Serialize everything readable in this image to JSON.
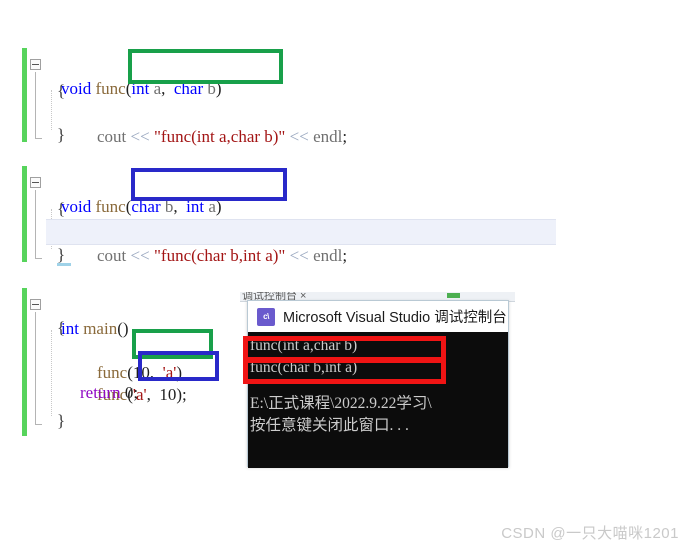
{
  "editor": {
    "language": "cpp",
    "functions": [
      {
        "signature_prefix": "void func",
        "params": "(int a,  char b)",
        "open_brace": "{",
        "body": "cout << \"func(int a,char b)\" << endl;",
        "close_brace": "}"
      },
      {
        "signature_prefix": "void func",
        "params": "(char b,  int a)",
        "open_brace": "{",
        "body": "cout << \"func(char b,int a)\" << endl;",
        "close_brace": "}"
      }
    ],
    "main": {
      "signature": "int main()",
      "open_brace": "{",
      "call1_prefix": "func",
      "call1_args": "(10,  'a')",
      "call2_prefix": "func",
      "call2_args": "('a',  10);",
      "return_stmt": "return 0;",
      "close_brace": "}"
    },
    "tokens": {
      "kw_void": "void",
      "kw_int": "int",
      "kw_char": "int",
      "kw_return": "return",
      "id_cout": "cout",
      "id_endl": "endl",
      "op_shift": "<<"
    },
    "colors": {
      "keyword": "#0000ff",
      "function": "#8a6a3b",
      "identifier": "#707070",
      "string": "#a31515",
      "operator": "#9aa8c0",
      "return_keyword": "#8f08c4",
      "change_bar": "#57d45c",
      "current_line_bg": "#eef1fa"
    }
  },
  "annotations": {
    "green_label": "green-highlight-box",
    "blue_label": "blue-highlight-box",
    "red_label": "red-highlight-box",
    "green_color": "#18a04a",
    "blue_color": "#2929c9",
    "red_color": "#f01414"
  },
  "console": {
    "title": "Microsoft Visual Studio 调试控制台",
    "icon_text": "c\\",
    "output_line1": "func(int a,char b)",
    "output_line2": "func(char b,int a)",
    "path_line": "E:\\正式课程\\2022.9.22学习\\",
    "prompt_line": "按任意键关闭此窗口. . ."
  },
  "vs_strip": {
    "text": "调试控制台 ×"
  },
  "watermark": {
    "text": "CSDN @一只大喵咪1201"
  }
}
